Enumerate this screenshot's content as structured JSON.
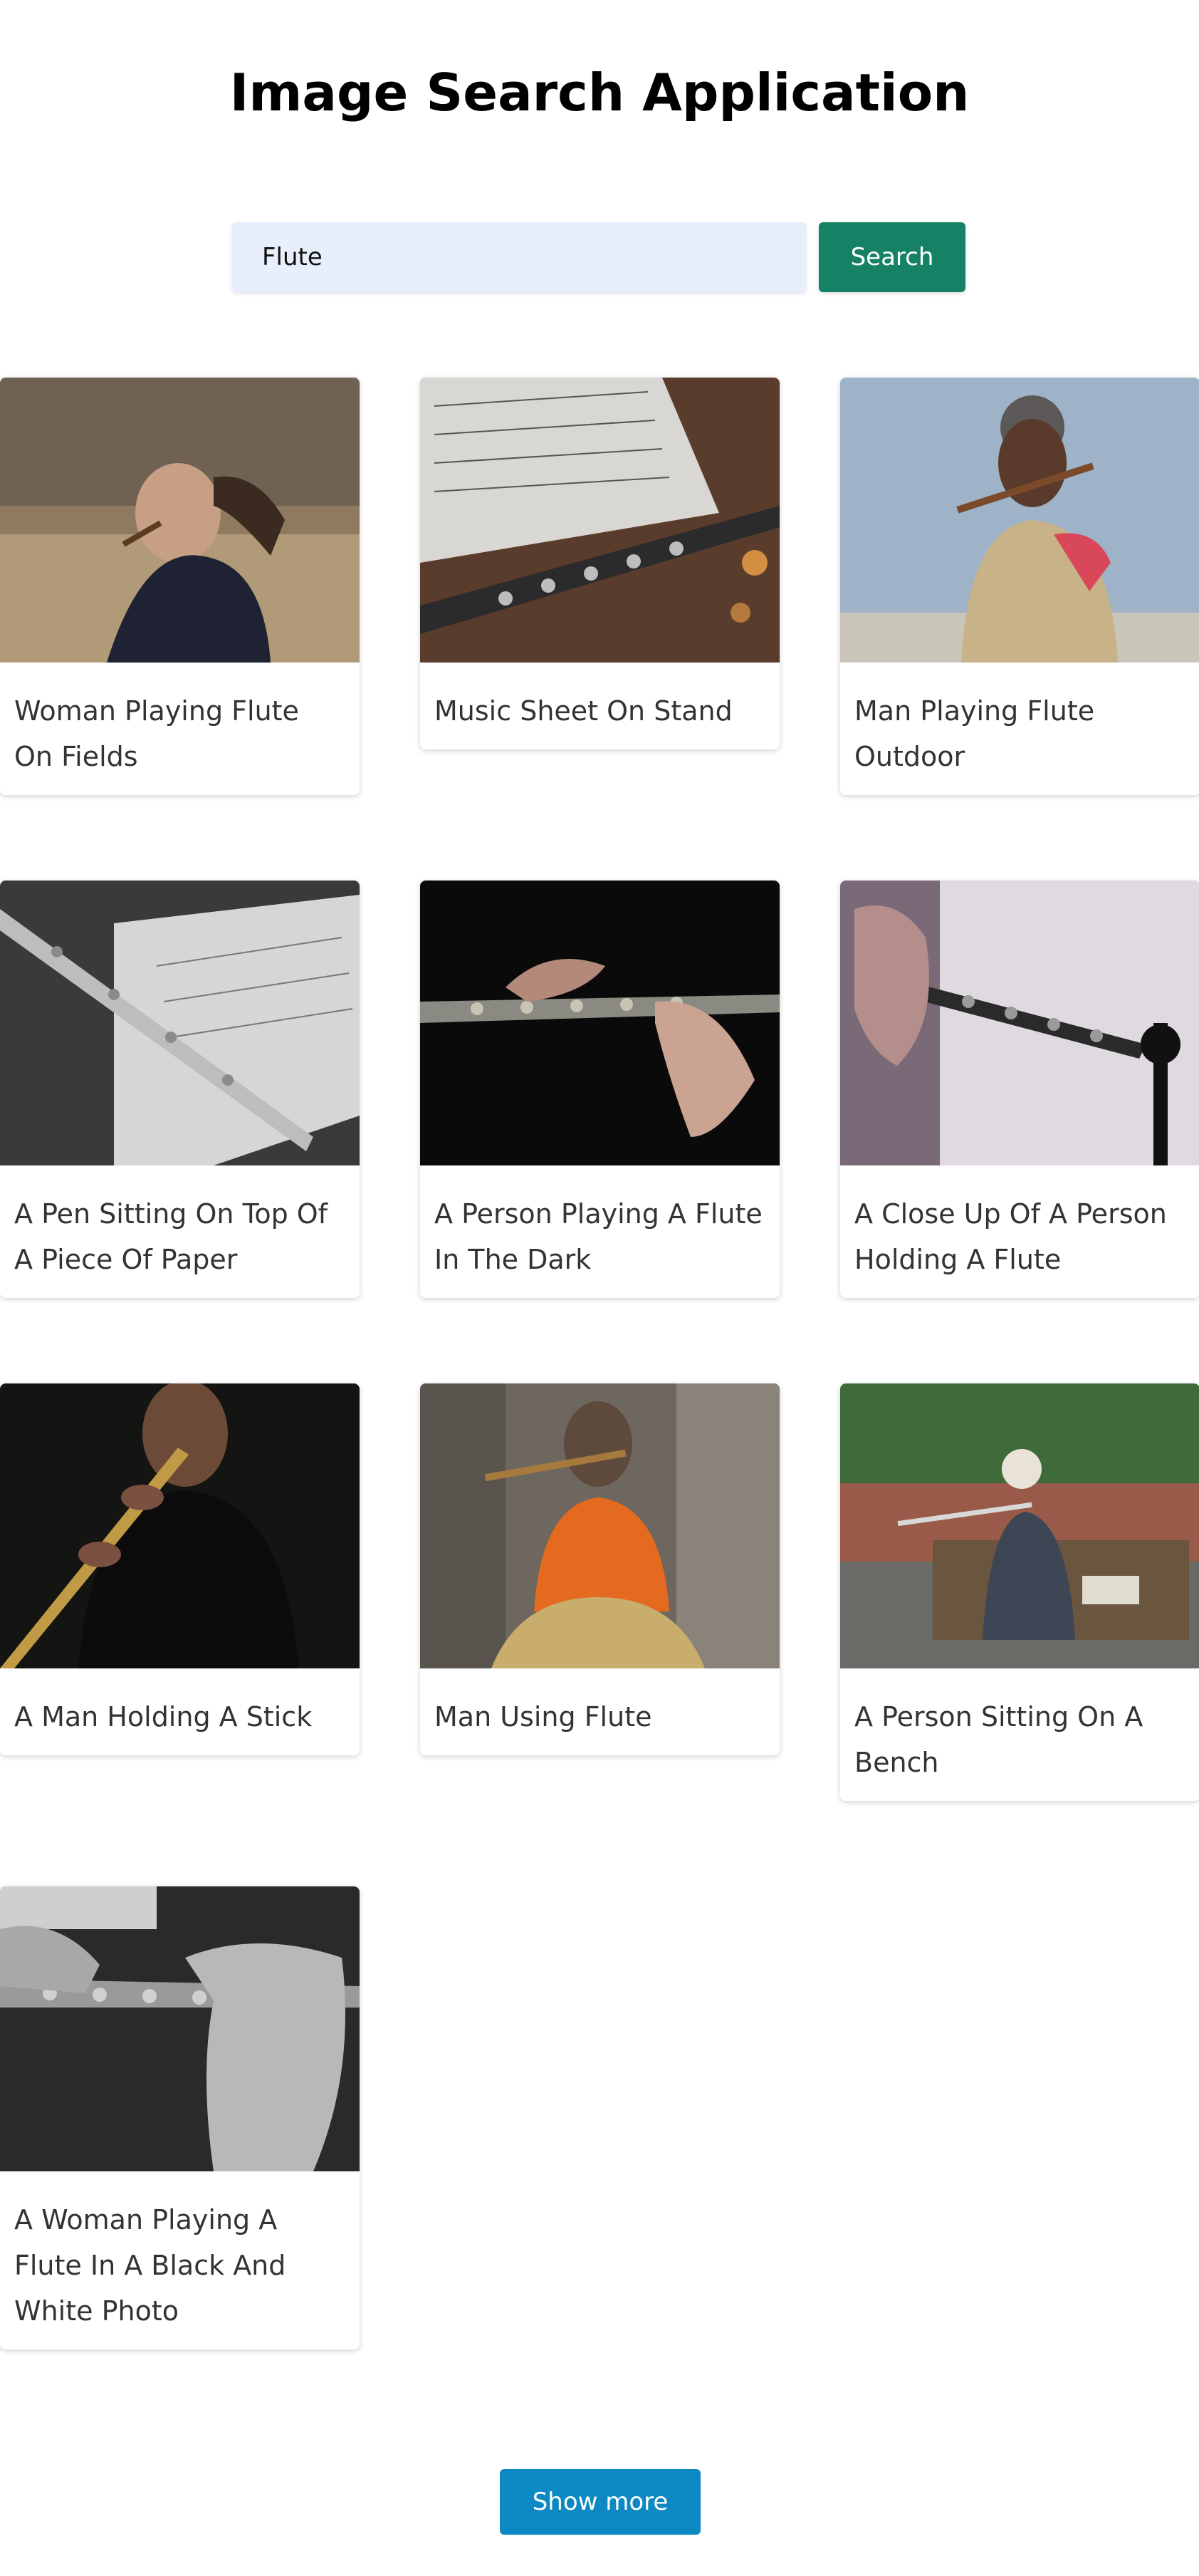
{
  "page": {
    "title": "Image Search Application"
  },
  "search": {
    "value": "Flute",
    "button_label": "Search"
  },
  "results": [
    {
      "caption": "Woman Playing Flute On Fields"
    },
    {
      "caption": "Music Sheet On Stand"
    },
    {
      "caption": "Man Playing Flute Outdoor"
    },
    {
      "caption": "A Pen Sitting On Top Of A Piece Of Paper"
    },
    {
      "caption": "A Person Playing A Flute In The Dark"
    },
    {
      "caption": "A Close Up Of A Person Holding A Flute"
    },
    {
      "caption": "A Man Holding A Stick"
    },
    {
      "caption": "Man Using Flute"
    },
    {
      "caption": "A Person Sitting On A Bench"
    },
    {
      "caption": "A Woman Playing A Flute In A Black And White Photo"
    }
  ],
  "pagination": {
    "show_more_label": "Show more"
  },
  "colors": {
    "search_button": "#158266",
    "show_more_button": "#0c88c3",
    "search_input_bg": "#e8effc"
  }
}
